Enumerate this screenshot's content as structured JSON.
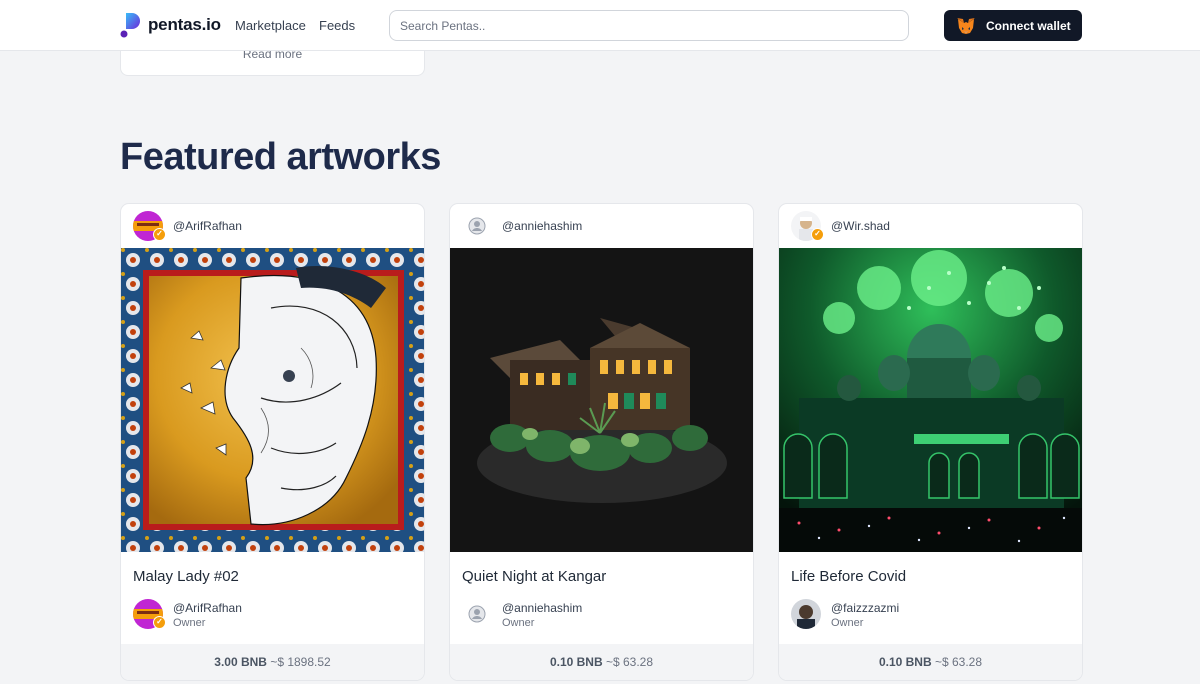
{
  "header": {
    "brand": "pentas.io",
    "nav": [
      "Marketplace",
      "Feeds"
    ],
    "search_placeholder": "Search Pentas..",
    "connect_label": "Connect wallet"
  },
  "previous_card": {
    "read_more": "Read more"
  },
  "section_title": "Featured artworks",
  "artworks": [
    {
      "creator": "@ArifRafhan",
      "title": "Malay Lady #02",
      "owner": "@ArifRafhan",
      "owner_role": "Owner",
      "price": "3.00 BNB",
      "price_usd": "~$ 1898.52"
    },
    {
      "creator": "@anniehashim",
      "title": "Quiet Night at Kangar",
      "owner": "@anniehashim",
      "owner_role": "Owner",
      "price": "0.10 BNB",
      "price_usd": "~$ 63.28"
    },
    {
      "creator": "@Wir.shad",
      "title": "Life Before Covid",
      "owner": "@faizzzazmi",
      "owner_role": "Owner",
      "price": "0.10 BNB",
      "price_usd": "~$ 63.28"
    }
  ],
  "colors": {
    "title": "#1e2a4a",
    "button": "#111827",
    "verified": "#f59e0b"
  }
}
